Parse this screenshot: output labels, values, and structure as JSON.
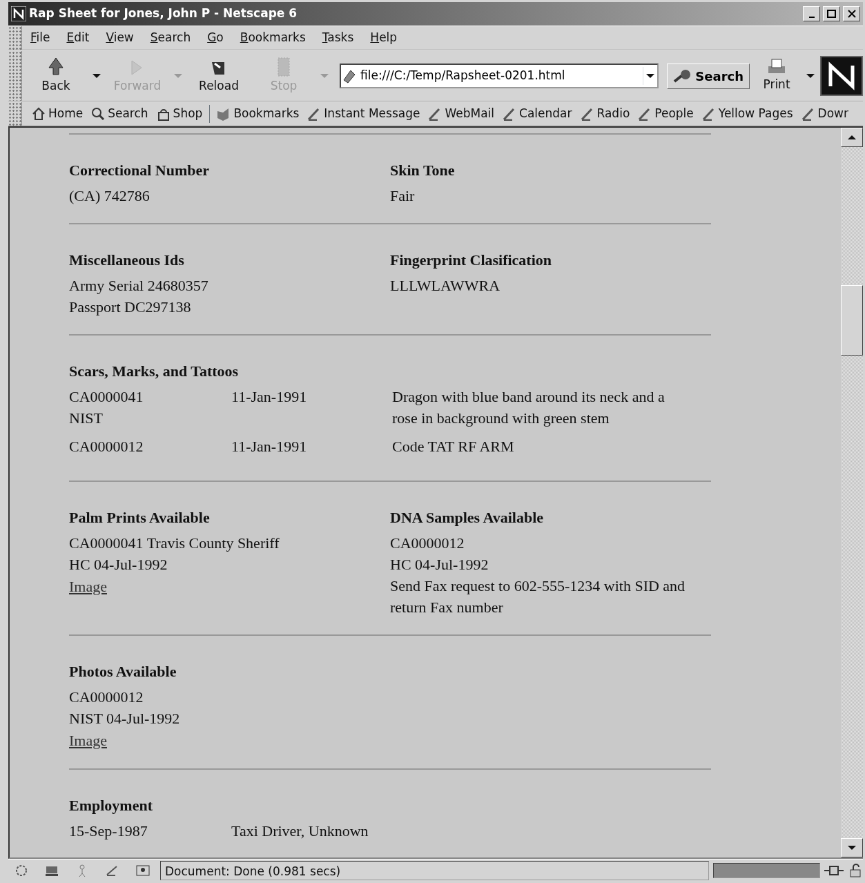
{
  "window": {
    "title": "Rap Sheet for Jones, John P - Netscape 6"
  },
  "menu": [
    "File",
    "Edit",
    "View",
    "Search",
    "Go",
    "Bookmarks",
    "Tasks",
    "Help"
  ],
  "nav_buttons": [
    {
      "label": "Back",
      "kind": "back",
      "disabled": false
    },
    {
      "label": "Forward",
      "kind": "forward",
      "disabled": true
    },
    {
      "label": "Reload",
      "kind": "reload",
      "disabled": false
    },
    {
      "label": "Stop",
      "kind": "stop",
      "disabled": true
    }
  ],
  "address": {
    "value": "file:///C:/Temp/Rapsheet-0201.html"
  },
  "search_button": "Search",
  "print_button": "Print",
  "personal_toolbar": [
    {
      "label": "Home",
      "kind": "home"
    },
    {
      "label": "Search",
      "kind": "search"
    },
    {
      "label": "Shop",
      "kind": "shop"
    },
    {
      "label": "Bookmarks",
      "kind": "bookmarks"
    },
    {
      "label": "Instant Message",
      "kind": "link"
    },
    {
      "label": "WebMail",
      "kind": "link"
    },
    {
      "label": "Calendar",
      "kind": "link"
    },
    {
      "label": "Radio",
      "kind": "link"
    },
    {
      "label": "People",
      "kind": "link"
    },
    {
      "label": "Yellow Pages",
      "kind": "link"
    },
    {
      "label": "Dowr",
      "kind": "link"
    }
  ],
  "sections": [
    {
      "kind": "pair",
      "columns": [
        {
          "heading": "Correctional Number",
          "lines": [
            "(CA) 742786"
          ]
        },
        {
          "heading": "Skin Tone",
          "lines": [
            "Fair"
          ]
        }
      ]
    },
    {
      "kind": "pair",
      "columns": [
        {
          "heading": "Miscellaneous Ids",
          "lines": [
            "Army Serial 24680357",
            "Passport DC297138"
          ]
        },
        {
          "heading": "Fingerprint Clasification",
          "lines": [
            "LLLWLAWWRA"
          ]
        }
      ]
    },
    {
      "kind": "records",
      "heading": "Scars, Marks, and Tattoos",
      "rows": [
        {
          "cells": [
            "CA0000041 NIST",
            "11-Jan-1991",
            "Dragon with blue band around its neck and a rose in background with green stem"
          ]
        },
        {
          "cells": [
            "CA0000012",
            "11-Jan-1991",
            "Code TAT RF ARM"
          ]
        }
      ]
    },
    {
      "kind": "pair",
      "columns": [
        {
          "heading": "Palm Prints Available",
          "lines": [
            "CA0000041 Travis County Sheriff",
            "HC 04-Jul-1992"
          ],
          "link": "Image"
        },
        {
          "heading": "DNA Samples Available",
          "lines": [
            "CA0000012",
            "HC 04-Jul-1992",
            "Send Fax request to 602-555-1234 with SID and return Fax number"
          ]
        }
      ]
    },
    {
      "kind": "pair",
      "columns": [
        {
          "heading": "Photos Available",
          "lines": [
            "CA0000012",
            "NIST 04-Jul-1992"
          ],
          "link": "Image"
        }
      ]
    },
    {
      "kind": "records",
      "heading": "Employment",
      "rows": [
        {
          "cells": [
            "15-Sep-1987",
            "Taxi Driver, Unknown"
          ]
        }
      ]
    }
  ],
  "status_bar": {
    "text": "Document: Done (0.981 secs)",
    "progress": {
      "level": 1
    }
  }
}
